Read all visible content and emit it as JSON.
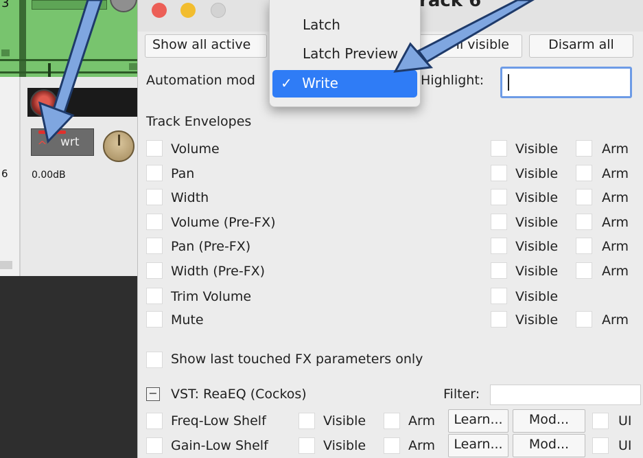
{
  "daw": {
    "track_number_top": "3",
    "track_number": "6",
    "automation_button_label": "wrt",
    "volume_readout": "0.00dB"
  },
  "window": {
    "title": "rack 6",
    "buttons": {
      "show_all_active": "Show all active",
      "all_visible": "ll visible",
      "disarm_all": "Disarm all"
    },
    "automation_mode_label": "Automation mod",
    "highlight_label": "Highlight:",
    "highlight_value": "",
    "track_envelopes_heading": "Track Envelopes",
    "visible_label": "Visible",
    "arm_label": "Arm",
    "envelopes": [
      {
        "name": "Volume",
        "has_arm": true
      },
      {
        "name": "Pan",
        "has_arm": true
      },
      {
        "name": "Width",
        "has_arm": true
      },
      {
        "name": "Volume (Pre-FX)",
        "has_arm": true
      },
      {
        "name": "Pan (Pre-FX)",
        "has_arm": true
      },
      {
        "name": "Width (Pre-FX)",
        "has_arm": true
      },
      {
        "name": "Trim Volume",
        "has_arm": false
      },
      {
        "name": "Mute",
        "has_arm": true
      }
    ],
    "show_last_touched": "Show last touched FX parameters only",
    "fx_section": {
      "collapse_symbol": "−",
      "title": "VST: ReaEQ (Cockos)",
      "filter_label": "Filter:",
      "filter_value": "",
      "params": [
        {
          "name": "Freq-Low Shelf",
          "visible": "Visible",
          "arm": "Arm",
          "learn": "Learn...",
          "mod": "Mod...",
          "ui": "UI"
        },
        {
          "name": "Gain-Low Shelf",
          "visible": "Visible",
          "arm": "Arm",
          "learn": "Learn...",
          "mod": "Mod...",
          "ui": "UI"
        }
      ]
    }
  },
  "menu": {
    "items": [
      {
        "label": "Latch",
        "selected": false
      },
      {
        "label": "Latch Preview",
        "selected": false
      },
      {
        "label": "Write",
        "selected": true
      }
    ],
    "checkmark": "✓"
  },
  "colors": {
    "track_green": "#78c46e",
    "menu_selection": "#2f7cf6",
    "arrow": "#6a95d6",
    "highlight_focus": "#6d9be6"
  }
}
